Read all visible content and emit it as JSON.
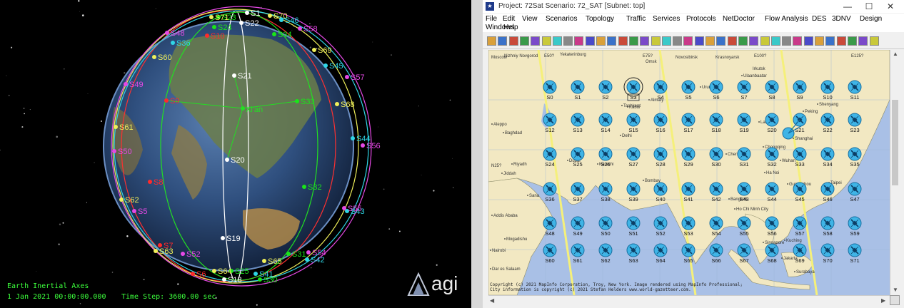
{
  "left_view": {
    "axes_label": "Earth Inertial Axes",
    "datetime": "1 Jan 2021 00:00:00.000",
    "timestep": "Time Step: 3600.00 sec",
    "logo_text": "agi",
    "ground_station": "Xi'an",
    "satellites": [
      {
        "name": "S1",
        "color": "#ffffff"
      },
      {
        "name": "S22",
        "color": "#ffffff"
      },
      {
        "name": "S21",
        "color": "#ffffff"
      },
      {
        "name": "S20",
        "color": "#ffffff"
      },
      {
        "name": "S19",
        "color": "#ffffff"
      },
      {
        "name": "S18",
        "color": "#ffffff"
      },
      {
        "name": "S23",
        "color": "#19e519"
      },
      {
        "name": "S24",
        "color": "#19e519"
      },
      {
        "name": "S34",
        "color": "#19e519"
      },
      {
        "name": "S33",
        "color": "#19e519"
      },
      {
        "name": "S32",
        "color": "#19e519"
      },
      {
        "name": "S31",
        "color": "#19e519"
      },
      {
        "name": "S30",
        "color": "#19e519"
      },
      {
        "name": "S25",
        "color": "#19e519"
      },
      {
        "name": "S70",
        "color": "#f0f05a"
      },
      {
        "name": "S71",
        "color": "#f0f05a"
      },
      {
        "name": "S60",
        "color": "#f0f05a"
      },
      {
        "name": "S61",
        "color": "#f0f05a"
      },
      {
        "name": "S62",
        "color": "#f0f05a"
      },
      {
        "name": "S63",
        "color": "#f0f05a"
      },
      {
        "name": "S64",
        "color": "#f0f05a"
      },
      {
        "name": "S65",
        "color": "#f0f05a"
      },
      {
        "name": "S69",
        "color": "#f0f05a"
      },
      {
        "name": "S68",
        "color": "#f0f05a"
      },
      {
        "name": "S46",
        "color": "#2fd6e6"
      },
      {
        "name": "S45",
        "color": "#2fd6e6"
      },
      {
        "name": "S44",
        "color": "#2fd6e6"
      },
      {
        "name": "S43",
        "color": "#2fd6e6"
      },
      {
        "name": "S42",
        "color": "#2fd6e6"
      },
      {
        "name": "S41",
        "color": "#2fd6e6"
      },
      {
        "name": "S36",
        "color": "#2fd6e6"
      },
      {
        "name": "S58",
        "color": "#e649e6"
      },
      {
        "name": "S57",
        "color": "#e649e6"
      },
      {
        "name": "S56",
        "color": "#e649e6"
      },
      {
        "name": "S55",
        "color": "#e649e6"
      },
      {
        "name": "S54",
        "color": "#e649e6"
      },
      {
        "name": "S52",
        "color": "#e649e6"
      },
      {
        "name": "S50",
        "color": "#e649e6"
      },
      {
        "name": "S49",
        "color": "#e649e6"
      },
      {
        "name": "S48",
        "color": "#e649e6"
      },
      {
        "name": "S5",
        "color": "#e649e6"
      },
      {
        "name": "S10",
        "color": "#ff2a2a"
      },
      {
        "name": "S9",
        "color": "#ff2a2a"
      },
      {
        "name": "S8",
        "color": "#ff2a2a"
      },
      {
        "name": "S7",
        "color": "#ff2a2a"
      },
      {
        "name": "S6",
        "color": "#ff2a2a"
      }
    ]
  },
  "window": {
    "title": "Project: 72Sat Scenario: 72_SAT  [Subnet: top]",
    "minimize": "—",
    "maximize": "☐",
    "close": "✕"
  },
  "menu": [
    "File",
    "Edit",
    "View",
    "Scenarios",
    "Topology",
    "Traffic",
    "Services",
    "Protocols",
    "NetDoctor",
    "Flow Analysis",
    "DES",
    "3DNV",
    "Design",
    "Windows",
    "Help"
  ],
  "toolbar_count": 36,
  "map": {
    "copyright_line1": "Copyright (c) 2021 MapInfo Corporation, Troy, New York. Image rendered using MapInfo Professional;",
    "copyright_line2": "City information is copyright (c) 2021 Stefan Helders www.world-gazetteer.com.",
    "grid_labels": [
      "E50?",
      "Yekaterinburg",
      "E75?",
      "Omsk",
      "Novosibirsk",
      "Krasnoyarsk",
      "E100?",
      "E125?",
      "Moscow",
      "Nizhniy Novgorod",
      "Irkutsk",
      "N25?"
    ],
    "cities": [
      "Almaty",
      "Tashkent",
      "Kabul",
      "Karachi",
      "Delhi",
      "Bombay",
      "Aleppo",
      "Baghdad",
      "Riyadh",
      "Jiddah",
      "Dubai",
      "Sana",
      "Addis Ababa",
      "Mogadishu",
      "Nairobi",
      "Dar es Salaam",
      "Chongqing",
      "Wuhan",
      "Shanghai",
      "Shenyang",
      "Peking",
      "Lanzhou",
      "Ha Noi",
      "Bangkok",
      "Ho Chi Minh City",
      "Singapore",
      "Kuching",
      "Jakarta",
      "Surabaya",
      "Guangzhou",
      "Taipei",
      "Ulaanbaatar",
      "Urumqi",
      "Chengdu"
    ],
    "node_rows": [
      [
        "S0",
        "S1",
        "S2",
        "S3",
        "S4",
        "S5",
        "S6",
        "S7",
        "S8",
        "S9",
        "S10",
        "S11"
      ],
      [
        "S12",
        "S13",
        "S14",
        "S15",
        "S16",
        "S17",
        "S18",
        "S19",
        "S20",
        "S21",
        "S22",
        "S23"
      ],
      [
        "S24",
        "S25",
        "S26",
        "S27",
        "S28",
        "S29",
        "S30",
        "S31",
        "S32",
        "S33",
        "S34",
        "S35"
      ],
      [
        "S36",
        "S37",
        "S38",
        "S39",
        "S40",
        "S41",
        "S42",
        "S43",
        "S44",
        "S45",
        "S46",
        "S47"
      ],
      [
        "S48",
        "S49",
        "S50",
        "S51",
        "S52",
        "S53",
        "S54",
        "S55",
        "S56",
        "S57",
        "S58",
        "S59"
      ],
      [
        "S60",
        "S61",
        "S62",
        "S63",
        "S64",
        "S65",
        "S66",
        "S67",
        "S68",
        "S69",
        "S70",
        "S71"
      ]
    ],
    "selected_node": "S3"
  }
}
